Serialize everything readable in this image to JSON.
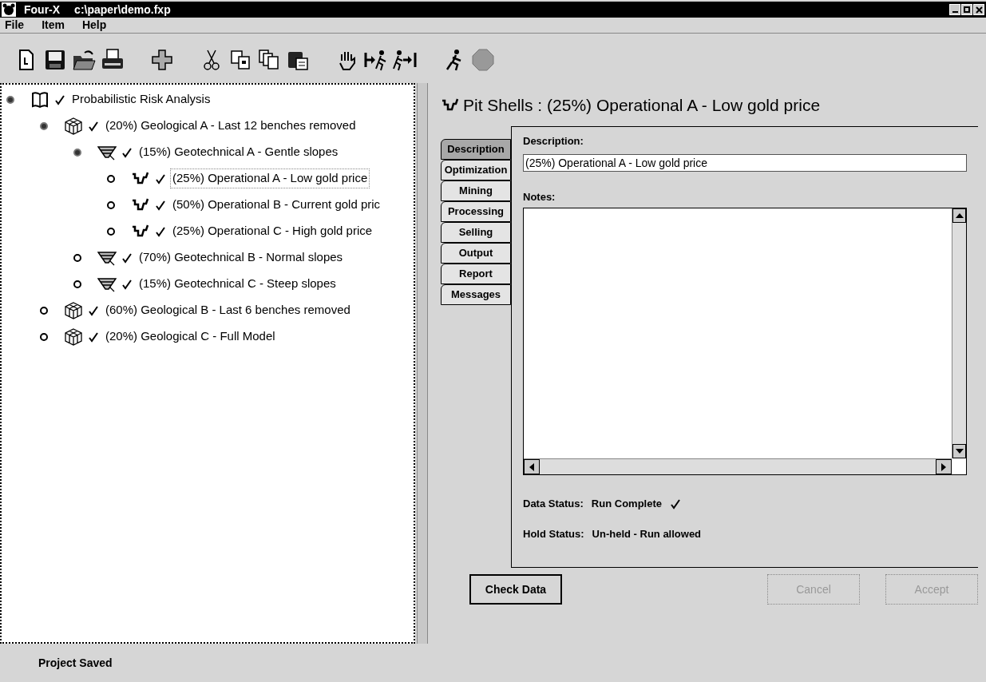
{
  "window": {
    "title": "Four-X",
    "path": "c:\\paper\\demo.fxp"
  },
  "menu": [
    "File",
    "Item",
    "Help"
  ],
  "toolbar": [
    {
      "kind": "new"
    },
    {
      "kind": "save"
    },
    {
      "kind": "open"
    },
    {
      "kind": "print"
    },
    {
      "kind": "add"
    },
    {
      "kind": "cut"
    },
    {
      "kind": "copy"
    },
    {
      "kind": "copy2"
    },
    {
      "kind": "paste"
    },
    {
      "kind": "hand"
    },
    {
      "kind": "run-in"
    },
    {
      "kind": "run-out"
    },
    {
      "kind": "run"
    },
    {
      "kind": "stop"
    }
  ],
  "tree": [
    {
      "kind": "root",
      "label": "Probabilistic Risk Analysis",
      "expanded": true,
      "selected": false,
      "children": [
        {
          "kind": "geological",
          "label": "(20%) Geological A - Last 12 benches removed",
          "expanded": true,
          "selected": false,
          "children": [
            {
              "kind": "geotechnical",
              "label": "(15%) Geotechnical A - Gentle slopes",
              "expanded": true,
              "selected": false,
              "children": [
                {
                  "kind": "operational",
                  "label": "(25%) Operational A - Low gold price",
                  "expanded": false,
                  "selected": true
                },
                {
                  "kind": "operational",
                  "label": "(50%) Operational B - Current gold pric",
                  "expanded": false,
                  "selected": false
                },
                {
                  "kind": "operational",
                  "label": "(25%) Operational C - High gold price",
                  "expanded": false,
                  "selected": false
                }
              ]
            },
            {
              "kind": "geotechnical",
              "label": "(70%) Geotechnical B - Normal slopes",
              "expanded": false,
              "selected": false
            },
            {
              "kind": "geotechnical",
              "label": "(15%) Geotechnical C - Steep slopes",
              "expanded": false,
              "selected": false
            }
          ]
        },
        {
          "kind": "geological",
          "label": "(60%) Geological B - Last 6 benches removed",
          "expanded": false,
          "selected": false
        },
        {
          "kind": "geological",
          "label": "(20%) Geological C - Full Model",
          "expanded": false,
          "selected": false
        }
      ]
    }
  ],
  "detail": {
    "heading": "Pit Shells : (25%) Operational A - Low gold price",
    "tabs": [
      {
        "label": "Description",
        "selected": true
      },
      {
        "label": "Optimization",
        "selected": false
      },
      {
        "label": "Mining",
        "selected": false
      },
      {
        "label": "Processing",
        "selected": false
      },
      {
        "label": "Selling",
        "selected": false
      },
      {
        "label": "Output",
        "selected": false
      },
      {
        "label": "Report",
        "selected": false
      },
      {
        "label": "Messages",
        "selected": false
      }
    ],
    "description_label": "Description:",
    "description_value": "(25%) Operational A - Low gold price",
    "notes_label": "Notes:",
    "data_status_label": "Data Status:",
    "data_status_value": "Run Complete",
    "data_status_complete": true,
    "hold_status_label": "Hold Status:",
    "hold_status_value": "Un-held - Run allowed",
    "buttons": [
      {
        "label": "Check Data",
        "disabled": false
      },
      {
        "label": "Cancel",
        "disabled": true
      },
      {
        "label": "Accept",
        "disabled": true
      }
    ]
  },
  "status_bar": "Project Saved"
}
